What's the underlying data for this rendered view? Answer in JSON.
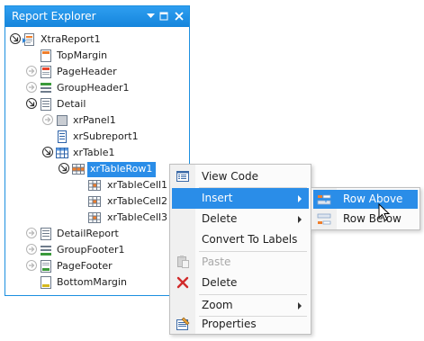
{
  "panel": {
    "title": "Report Explorer",
    "pin_icon": "pin-icon",
    "close_icon": "close-icon"
  },
  "tree": {
    "nodes": [
      {
        "label": "XtraReport1",
        "icon": "report-icon",
        "expander": "open"
      },
      {
        "label": "TopMargin",
        "icon": "top-margin-band-icon",
        "expander": "none"
      },
      {
        "label": "PageHeader",
        "icon": "page-header-band-icon",
        "expander": "collapsed"
      },
      {
        "label": "GroupHeader1",
        "icon": "group-header-band-icon",
        "expander": "collapsed"
      },
      {
        "label": "Detail",
        "icon": "detail-band-icon",
        "expander": "open"
      },
      {
        "label": "xrPanel1",
        "icon": "panel-icon",
        "expander": "collapsed"
      },
      {
        "label": "xrSubreport1",
        "icon": "subreport-icon",
        "expander": "none"
      },
      {
        "label": "xrTable1",
        "icon": "table-icon",
        "expander": "open"
      },
      {
        "label": "xrTableRow1",
        "icon": "table-row-icon",
        "expander": "open",
        "selected": true
      },
      {
        "label": "xrTableCell1",
        "icon": "table-cell-icon",
        "expander": "none"
      },
      {
        "label": "xrTableCell2",
        "icon": "table-cell-icon",
        "expander": "none"
      },
      {
        "label": "xrTableCell3",
        "icon": "table-cell-icon",
        "expander": "none"
      },
      {
        "label": "DetailReport",
        "icon": "detail-report-band-icon",
        "expander": "collapsed"
      },
      {
        "label": "GroupFooter1",
        "icon": "group-footer-band-icon",
        "expander": "collapsed"
      },
      {
        "label": "PageFooter",
        "icon": "page-footer-band-icon",
        "expander": "collapsed"
      },
      {
        "label": "BottomMargin",
        "icon": "bottom-margin-band-icon",
        "expander": "none"
      }
    ]
  },
  "context_menu": {
    "items": [
      {
        "label": "View Code",
        "icon": "view-code-icon"
      },
      {
        "label": "Insert",
        "submenu": true,
        "highlighted": true
      },
      {
        "label": "Delete",
        "submenu": true
      },
      {
        "label": "Convert To Labels"
      },
      {
        "label": "Paste",
        "icon": "paste-icon",
        "disabled": true
      },
      {
        "label": "Delete",
        "icon": "delete-icon"
      },
      {
        "label": "Zoom",
        "submenu": true
      },
      {
        "label": "Properties",
        "icon": "properties-icon"
      }
    ]
  },
  "submenu": {
    "items": [
      {
        "label": "Row Above",
        "icon": "insert-row-above-icon",
        "highlighted": true
      },
      {
        "label": "Row Below",
        "icon": "insert-row-below-icon"
      }
    ]
  },
  "colors": {
    "accent": "#2a8de8",
    "title_bar": "#1c8fe0",
    "disabled_text": "#a8a8a8"
  }
}
